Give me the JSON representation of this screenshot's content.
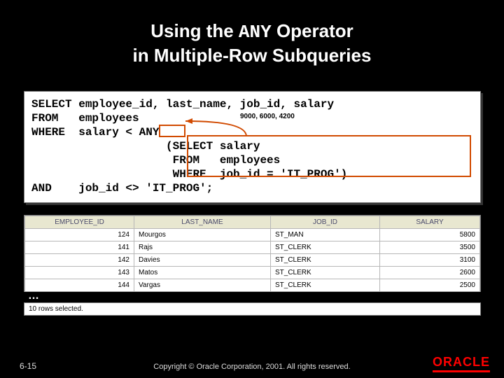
{
  "title": {
    "part1": "Using the ",
    "code": "ANY",
    "part2": " Operator\nin Multiple-Row Subqueries"
  },
  "code_block": "SELECT employee_id, last_name, job_id, salary\nFROM   employees\nWHERE  salary < ANY\n                    (SELECT salary\n                     FROM   employees\n                     WHERE  job_id = 'IT_PROG')\nAND    job_id <> 'IT_PROG';",
  "values_note": "9000, 6000, 4200",
  "result": {
    "headers": [
      "EMPLOYEE_ID",
      "LAST_NAME",
      "JOB_ID",
      "SALARY"
    ],
    "rows": [
      {
        "employee_id": "124",
        "last_name": "Mourgos",
        "job_id": "ST_MAN",
        "salary": "5800"
      },
      {
        "employee_id": "141",
        "last_name": "Rajs",
        "job_id": "ST_CLERK",
        "salary": "3500"
      },
      {
        "employee_id": "142",
        "last_name": "Davies",
        "job_id": "ST_CLERK",
        "salary": "3100"
      },
      {
        "employee_id": "143",
        "last_name": "Matos",
        "job_id": "ST_CLERK",
        "salary": "2600"
      },
      {
        "employee_id": "144",
        "last_name": "Vargas",
        "job_id": "ST_CLERK",
        "salary": "2500"
      }
    ],
    "ellipsis": "…",
    "status": "10 rows selected."
  },
  "footer": {
    "page": "6-15",
    "copyright": "Copyright © Oracle Corporation, 2001. All rights reserved.",
    "logo": "ORACLE"
  }
}
